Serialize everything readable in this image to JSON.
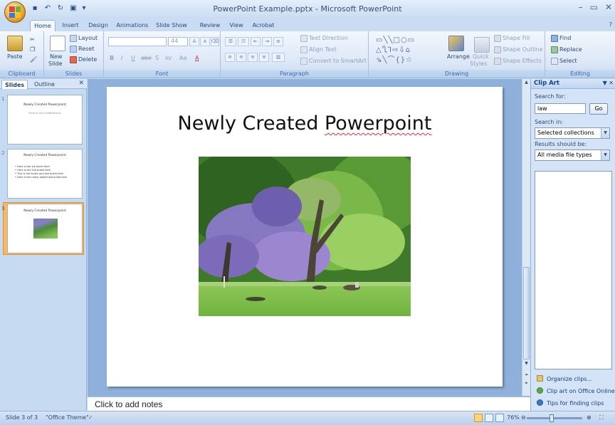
{
  "window": {
    "title": "PowerPoint Example.pptx - Microsoft PowerPoint",
    "minimize": "–",
    "maximize": "▭",
    "close": "✕"
  },
  "quick_access": {
    "save_icon": "save-icon",
    "undo_icon": "undo-icon",
    "redo_icon": "redo-icon",
    "customize_icon": "chevron-down-icon"
  },
  "tabs": [
    {
      "label": "Home",
      "active": true
    },
    {
      "label": "Insert"
    },
    {
      "label": "Design"
    },
    {
      "label": "Animations"
    },
    {
      "label": "Slide Show"
    },
    {
      "label": "Review"
    },
    {
      "label": "View"
    },
    {
      "label": "Acrobat"
    }
  ],
  "ribbon": {
    "clipboard": {
      "label": "Clipboard",
      "paste": "Paste"
    },
    "slides": {
      "label": "Slides",
      "new_slide_1": "New",
      "new_slide_2": "Slide",
      "layout": "Layout",
      "reset": "Reset",
      "delete": "Delete"
    },
    "font": {
      "label": "Font",
      "size": "44",
      "bold": "B",
      "italic": "I",
      "underline": "U",
      "strike": "abe",
      "shadow": "S",
      "spacing": "AV",
      "case": "Aa",
      "color": "A",
      "grow": "A",
      "shrink": "A"
    },
    "paragraph": {
      "label": "Paragraph",
      "text_direction": "Text Direction",
      "align_text": "Align Text",
      "smartart": "Convert to SmartArt"
    },
    "drawing": {
      "label": "Drawing",
      "arrange": "Arrange",
      "quick_styles_1": "Quick",
      "quick_styles_2": "Styles",
      "shape_fill": "Shape Fill",
      "shape_outline": "Shape Outline",
      "shape_effects": "Shape Effects"
    },
    "editing": {
      "label": "Editing",
      "find": "Find",
      "replace": "Replace",
      "select": "Select"
    }
  },
  "slides_pane": {
    "tab_slides": "Slides",
    "tab_outline": "Outline",
    "close": "✕",
    "thumbnails": [
      {
        "number": "1",
        "title": "Newly Created Powerpoint",
        "subtitle": "From to any modifications"
      },
      {
        "number": "2",
        "title": "Newly Created Powerpoint",
        "bullets": [
          "Here is the 1st bullet item",
          "Here is the 2nd bullet item",
          "This is the fourth and last bullet item",
          "Here is the newly added last bullet item"
        ]
      },
      {
        "number": "3",
        "title": "Newly Created Powerpoint",
        "selected": true
      }
    ]
  },
  "slide": {
    "title_part1": "Newly Created ",
    "title_part2": "Powerpoint"
  },
  "notes": {
    "placeholder": "Click to add notes"
  },
  "clip_art": {
    "title": "Clip Art",
    "search_for_label": "Search for:",
    "search_value": "law",
    "go": "Go",
    "search_in_label": "Search in:",
    "search_in_value": "Selected collections",
    "results_label": "Results should be:",
    "results_value": "All media file types",
    "links": [
      {
        "label": "Organize clips...",
        "icon": "folder-icon"
      },
      {
        "label": "Clip art on Office Online",
        "icon": "globe-icon"
      },
      {
        "label": "Tips for finding clips",
        "icon": "help-icon"
      }
    ]
  },
  "status": {
    "slide_info": "Slide 3 of 3",
    "theme": "\"Office Theme\"",
    "zoom": "76%"
  },
  "colors": {
    "ribbon_bg": "#dbe7f6",
    "selected_thumb": "#f8b864",
    "canvas_bg": "#8fb0da",
    "link": "#15428b"
  }
}
